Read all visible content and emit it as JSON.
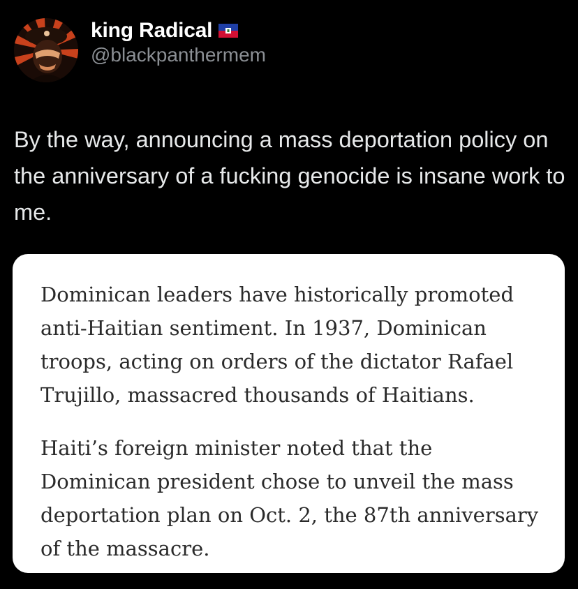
{
  "author": {
    "display_name": "king Radical",
    "handle": "@blackpanthermem",
    "avatar_icon": "stylized-portrait-avatar",
    "flag_icon": "haiti-flag-icon"
  },
  "post": {
    "text": "By the way, announcing a mass deportation policy on the anniversary of a fucking genocide is insane work to me."
  },
  "quote": {
    "paragraphs": [
      "Dominican leaders have historically promoted anti-Haitian sentiment. In 1937, Dominican troops, acting on orders of the dictator Rafael Trujillo, massacred thousands of Haitians.",
      "Haiti’s foreign minister noted that the Dominican president chose to unveil the mass deportation plan on Oct. 2, the 87th anniversary of the massacre."
    ]
  },
  "colors": {
    "background": "#000000",
    "name_text": "#ffffff",
    "handle_text": "#8b8f94",
    "body_text": "#e7e9ea",
    "card_background": "#ffffff",
    "card_text": "#2a2a2a",
    "flag_blue": "#1f3fa6",
    "flag_red": "#d21034"
  }
}
